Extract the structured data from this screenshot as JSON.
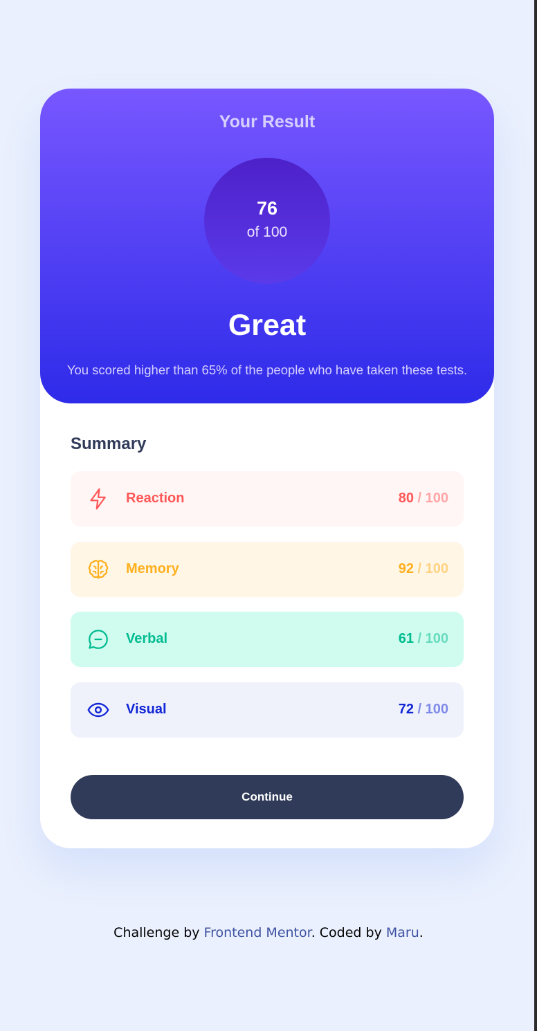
{
  "result": {
    "title": "Your Result",
    "score": "76",
    "score_total": "of 100",
    "rating": "Great",
    "description": "You scored higher than 65% of the people who have taken these tests."
  },
  "summary": {
    "title": "Summary",
    "items": [
      {
        "label": "Reaction",
        "score": "80",
        "max": " / 100",
        "icon": "lightning-icon",
        "color": "#ff5757"
      },
      {
        "label": "Memory",
        "score": "92",
        "max": " / 100",
        "icon": "brain-icon",
        "color": "#ffb01f"
      },
      {
        "label": "Verbal",
        "score": "61",
        "max": " / 100",
        "icon": "chat-bubble-icon",
        "color": "#00bb8f"
      },
      {
        "label": "Visual",
        "score": "72",
        "max": " / 100",
        "icon": "eye-icon",
        "color": "#1125d6"
      }
    ],
    "continue_label": "Continue"
  },
  "footer": {
    "prefix": "Challenge by ",
    "link1": "Frontend Mentor",
    "middle": ". Coded by ",
    "link2": "Maru",
    "suffix": "."
  },
  "colors": {
    "background": "#eaf0fd",
    "gradient_top": "#7857ff",
    "gradient_bottom": "#2e2be9",
    "button": "#303b59"
  }
}
